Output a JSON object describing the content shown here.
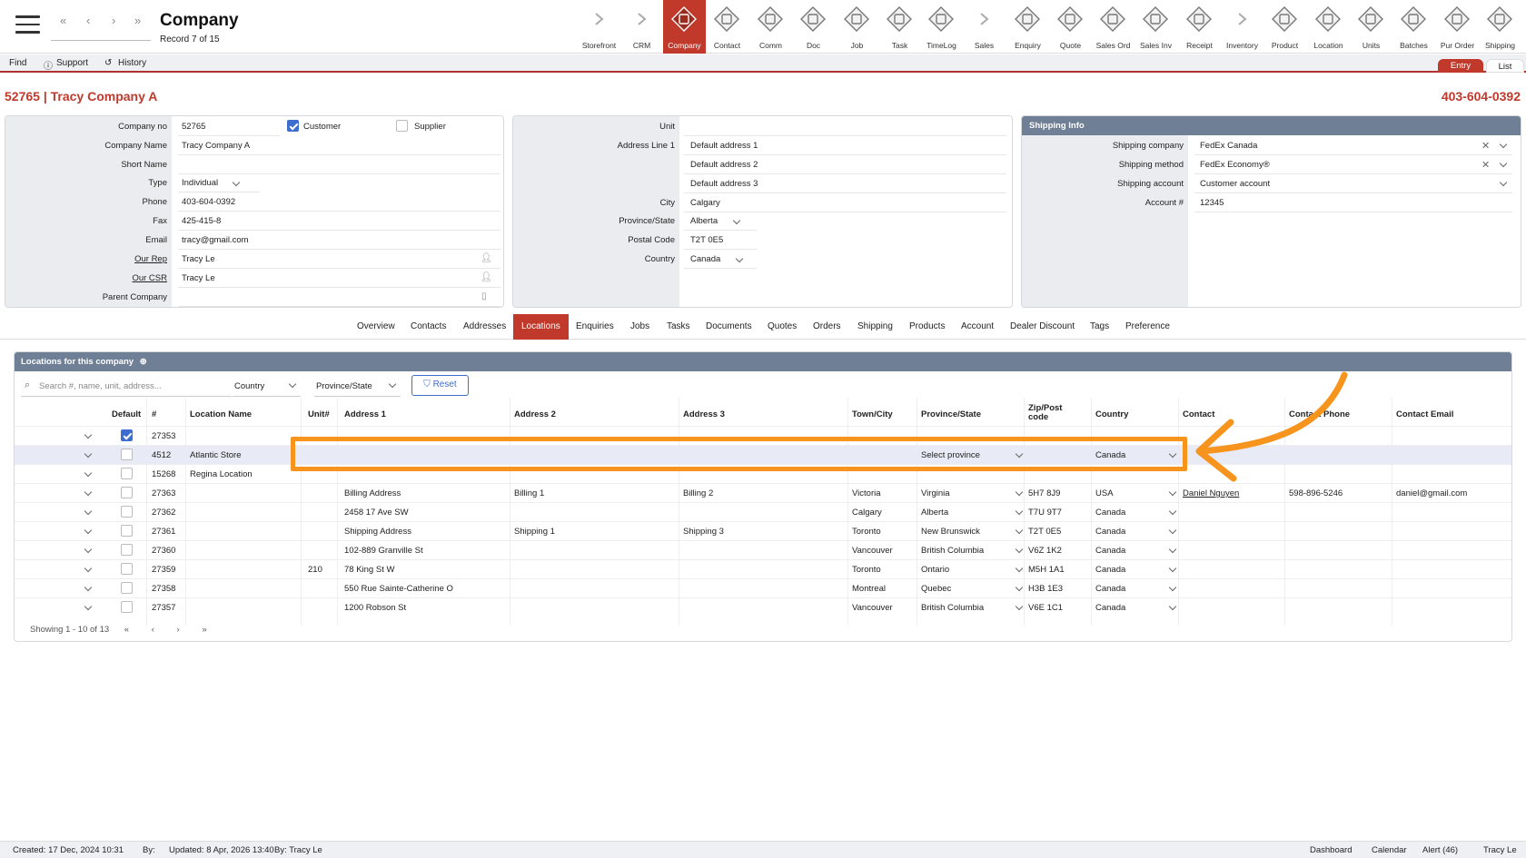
{
  "header": {
    "title": "Company",
    "record": "Record 7 of 15"
  },
  "modules": [
    "Storefront",
    "CRM",
    "Company",
    "Contact",
    "Comm",
    "Doc",
    "Job",
    "Task",
    "TimeLog",
    "Sales",
    "Enquiry",
    "Quote",
    "Sales Ord",
    "Sales Inv",
    "Receipt",
    "Inventory",
    "Product",
    "Location",
    "Units",
    "Batches",
    "Pur Order",
    "Shipping"
  ],
  "active_module": "Company",
  "secbar": {
    "find": "Find",
    "support": "Support",
    "history": "History",
    "entry": "Entry",
    "list": "List"
  },
  "company": {
    "title": "52765 | Tracy Company A",
    "phone_display": "403-604-0392"
  },
  "left_panel": [
    {
      "label": "Company no",
      "value": "52765"
    },
    {
      "label": "Company Name",
      "value": "Tracy Company A"
    },
    {
      "label": "Short Name",
      "value": ""
    },
    {
      "label": "Type",
      "value": "Individual"
    },
    {
      "label": "Phone",
      "value": "403-604-0392"
    },
    {
      "label": "Fax",
      "value": "425-415-8"
    },
    {
      "label": "Email",
      "value": "tracy@gmail.com"
    },
    {
      "label": "Our Rep",
      "value": "Tracy Le"
    },
    {
      "label": "Our CSR",
      "value": "Tracy Le"
    },
    {
      "label": "Parent Company",
      "value": ""
    }
  ],
  "checkboxes": {
    "customer": "Customer",
    "supplier": "Supplier"
  },
  "mid_panel": [
    {
      "label": "Unit",
      "value": ""
    },
    {
      "label": "Address Line 1",
      "value": "Default address 1"
    },
    {
      "label": "",
      "value": "Default address 2"
    },
    {
      "label": "",
      "value": "Default address 3"
    },
    {
      "label": "City",
      "value": "Calgary"
    },
    {
      "label": "Province/State",
      "value": "Alberta"
    },
    {
      "label": "Postal Code",
      "value": "T2T 0E5"
    },
    {
      "label": "Country",
      "value": "Canada"
    }
  ],
  "shipping": {
    "header": "Shipping Info",
    "fields": [
      {
        "label": "Shipping company",
        "value": "FedEx Canada"
      },
      {
        "label": "Shipping method",
        "value": "FedEx Economy®"
      },
      {
        "label": "Shipping account",
        "value": "Customer account"
      },
      {
        "label": "Account #",
        "value": "12345"
      }
    ]
  },
  "tabs": [
    "Overview",
    "Contacts",
    "Addresses",
    "Locations",
    "Enquiries",
    "Jobs",
    "Tasks",
    "Documents",
    "Quotes",
    "Orders",
    "Shipping",
    "Products",
    "Account",
    "Dealer Discount",
    "Tags",
    "Preference"
  ],
  "active_tab": "Locations",
  "locations": {
    "header": "Locations for this company",
    "search_placeholder": "Search #, name, unit, address...",
    "filter_country": "Country",
    "filter_province": "Province/State",
    "reset": "Reset",
    "columns": [
      "Default",
      "#",
      "Location Name",
      "Unit#",
      "Address 1",
      "Address 2",
      "Address 3",
      "Town/City",
      "Province/State",
      "Zip/Post code",
      "Country",
      "Contact",
      "Contact Phone",
      "Contact Email"
    ],
    "rows": [
      {
        "id": "27353",
        "name": "",
        "unit": "",
        "a1": "",
        "a2": "",
        "a3": "",
        "city": "",
        "prov": "",
        "zip": "",
        "country": "",
        "contact": "",
        "phone": "",
        "email": "",
        "def": true
      },
      {
        "id": "4512",
        "name": "Atlantic Store",
        "unit": "",
        "a1": "",
        "a2": "",
        "a3": "",
        "city": "",
        "prov": "Select province",
        "zip": "",
        "country": "Canada",
        "contact": "",
        "phone": "",
        "email": "",
        "def": false
      },
      {
        "id": "15268",
        "name": "Regina Location",
        "unit": "",
        "a1": "",
        "a2": "",
        "a3": "",
        "city": "",
        "prov": "",
        "zip": "",
        "country": "",
        "contact": "",
        "phone": "",
        "email": "",
        "def": false
      },
      {
        "id": "27363",
        "name": "",
        "unit": "",
        "a1": "Billing Address",
        "a2": "Billing 1",
        "a3": "Billing 2",
        "city": "Victoria",
        "prov": "Virginia",
        "zip": "5H7 8J9",
        "country": "USA",
        "contact": "Daniel Nguyen",
        "phone": "598-896-5246",
        "email": "daniel@gmail.com",
        "def": false
      },
      {
        "id": "27362",
        "name": "",
        "unit": "",
        "a1": "2458 17 Ave SW",
        "a2": "",
        "a3": "",
        "city": "Calgary",
        "prov": "Alberta",
        "zip": "T7U 9T7",
        "country": "Canada",
        "contact": "",
        "phone": "",
        "email": "",
        "def": false
      },
      {
        "id": "27361",
        "name": "",
        "unit": "",
        "a1": "Shipping Address",
        "a2": "Shipping 1",
        "a3": "Shipping 3",
        "city": "Toronto",
        "prov": "New Brunswick",
        "zip": "T2T 0E5",
        "country": "Canada",
        "contact": "",
        "phone": "",
        "email": "",
        "def": false
      },
      {
        "id": "27360",
        "name": "",
        "unit": "",
        "a1": "102-889 Granville St",
        "a2": "",
        "a3": "",
        "city": "Vancouver",
        "prov": "British Columbia",
        "zip": "V6Z 1K2",
        "country": "Canada",
        "contact": "",
        "phone": "",
        "email": "",
        "def": false
      },
      {
        "id": "27359",
        "name": "",
        "unit": "210",
        "a1": "78 King St W",
        "a2": "",
        "a3": "",
        "city": "Toronto",
        "prov": "Ontario",
        "zip": "M5H 1A1",
        "country": "Canada",
        "contact": "",
        "phone": "",
        "email": "",
        "def": false
      },
      {
        "id": "27358",
        "name": "",
        "unit": "",
        "a1": "550 Rue Sainte-Catherine O",
        "a2": "",
        "a3": "",
        "city": "Montreal",
        "prov": "Quebec",
        "zip": "H3B 1E3",
        "country": "Canada",
        "contact": "",
        "phone": "",
        "email": "",
        "def": false
      },
      {
        "id": "27357",
        "name": "",
        "unit": "",
        "a1": "1200 Robson St",
        "a2": "",
        "a3": "",
        "city": "Vancouver",
        "prov": "British Columbia",
        "zip": "V6E 1C1",
        "country": "Canada",
        "contact": "",
        "phone": "",
        "email": "",
        "def": false
      }
    ],
    "pager": "Showing 1 - 10 of 13"
  },
  "footer": {
    "created": "Created: 17 Dec, 2024   10:31",
    "by": "By:",
    "updated": "Updated: 8 Apr, 2026   13:40",
    "updated_by": "By: Tracy Le",
    "dashboard": "Dashboard",
    "calendar": "Calendar",
    "alert": "Alert (46)",
    "user": "Tracy Le"
  },
  "colors": {
    "accent": "#c0392b",
    "header_band": "#6f7f96",
    "highlight": "#f7941d",
    "link": "#3d6ecf"
  }
}
